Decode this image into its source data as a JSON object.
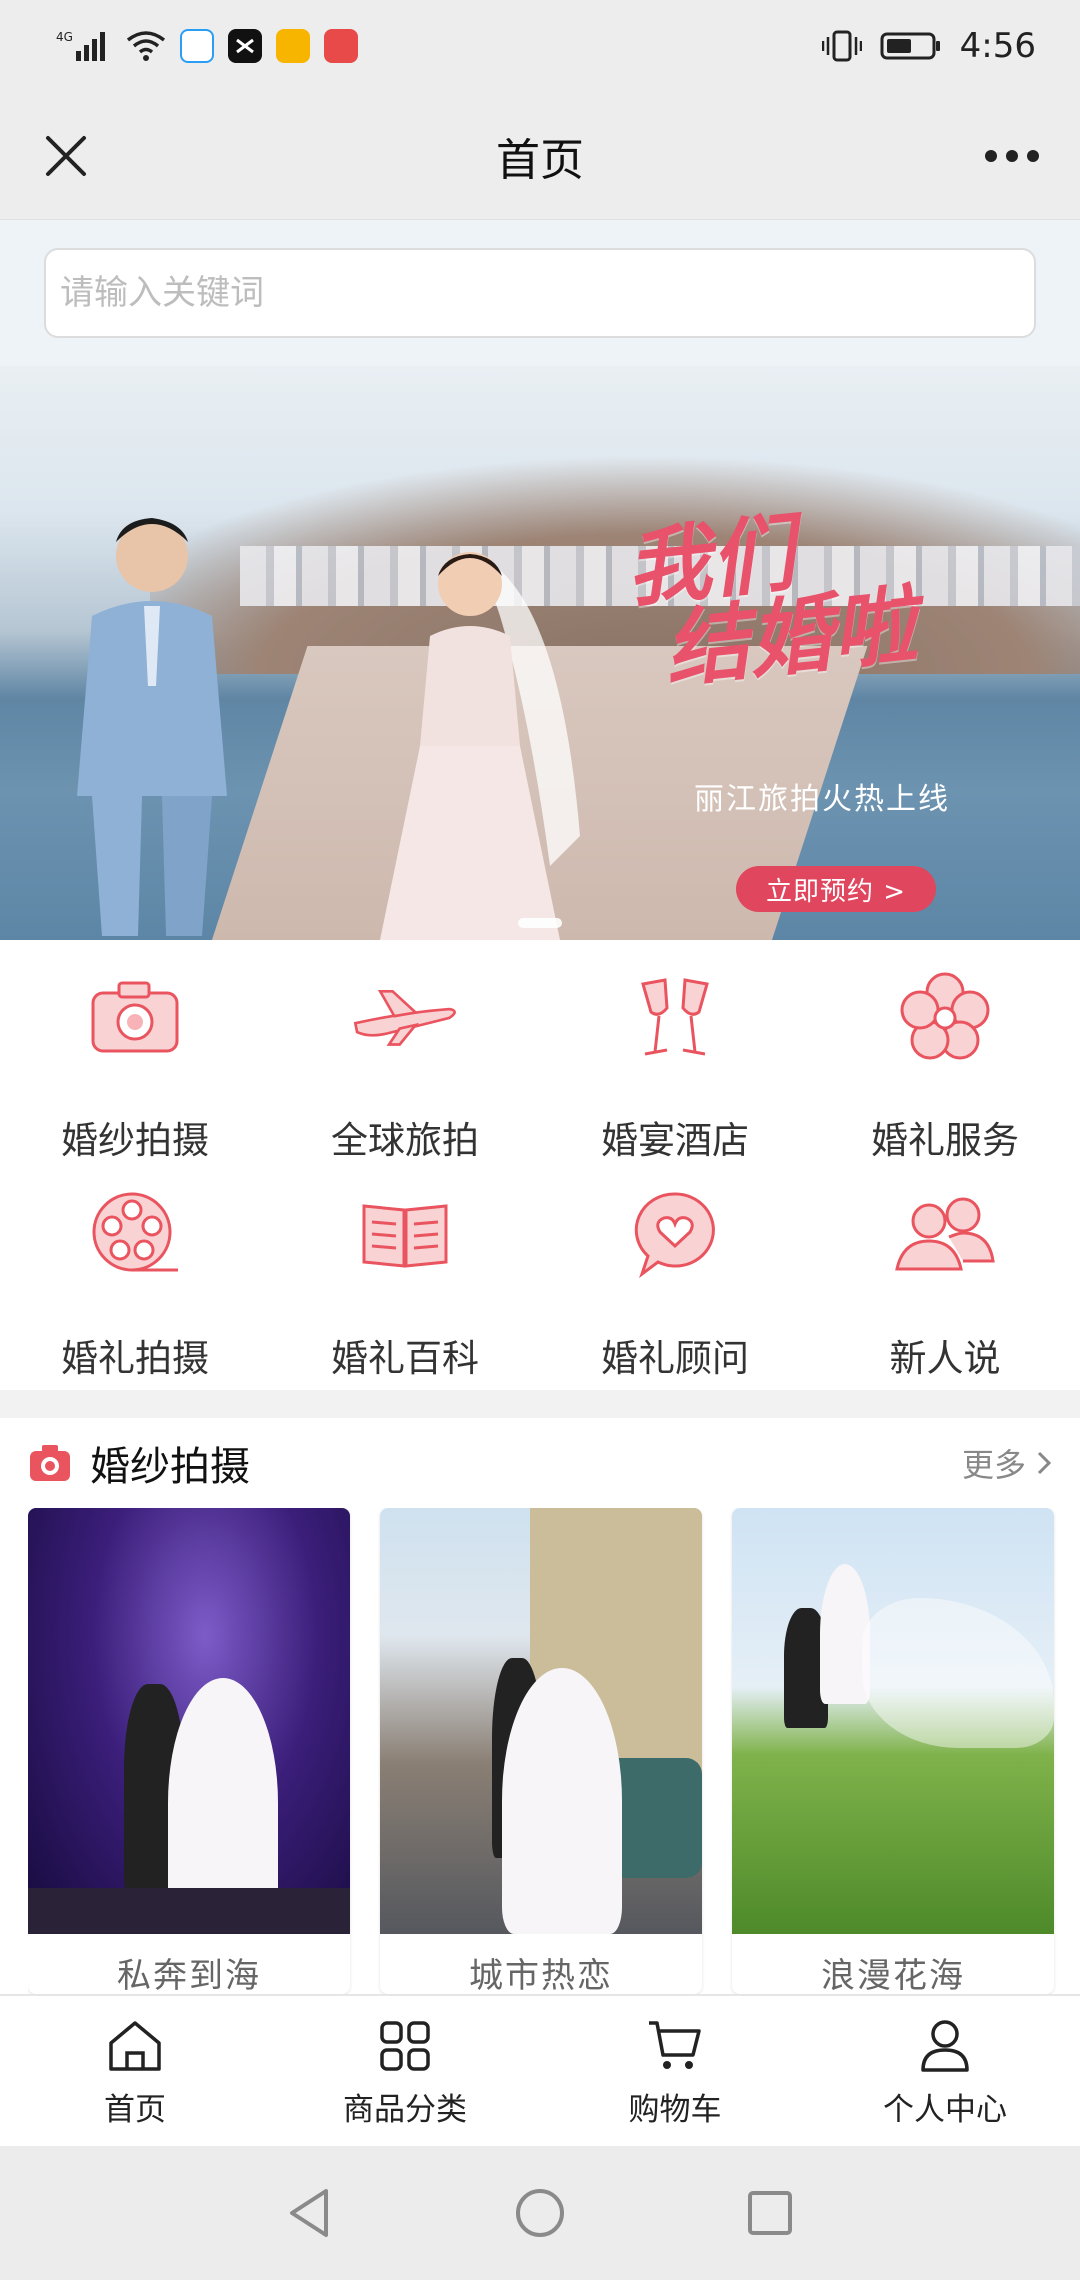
{
  "status_bar": {
    "network": "4G",
    "time": "4:56"
  },
  "title_bar": {
    "title": "首页"
  },
  "search": {
    "placeholder": "请输入关键词"
  },
  "banner": {
    "headline_line1": "我们",
    "headline_line2": "结婚啦",
    "subtitle": "丽江旅拍火热上线",
    "cta": "立即预约 >"
  },
  "categories": [
    {
      "label": "婚纱拍摄",
      "icon": "camera-icon"
    },
    {
      "label": "全球旅拍",
      "icon": "airplane-icon"
    },
    {
      "label": "婚宴酒店",
      "icon": "champagne-icon"
    },
    {
      "label": "婚礼服务",
      "icon": "flower-icon"
    },
    {
      "label": "婚礼拍摄",
      "icon": "film-reel-icon"
    },
    {
      "label": "婚礼百科",
      "icon": "book-icon"
    },
    {
      "label": "婚礼顾问",
      "icon": "heart-chat-icon"
    },
    {
      "label": "新人说",
      "icon": "couple-icon"
    }
  ],
  "section": {
    "title": "婚纱拍摄",
    "more": "更多"
  },
  "cards": [
    {
      "caption": "私奔到海"
    },
    {
      "caption": "城市热恋"
    },
    {
      "caption": "浪漫花海"
    }
  ],
  "tabbar": [
    {
      "label": "首页",
      "icon": "home-icon"
    },
    {
      "label": "商品分类",
      "icon": "grid-icon"
    },
    {
      "label": "购物车",
      "icon": "cart-icon"
    },
    {
      "label": "个人中心",
      "icon": "person-icon"
    }
  ],
  "colors": {
    "accent": "#e9545f",
    "icon_fill": "#f7c7c9"
  }
}
